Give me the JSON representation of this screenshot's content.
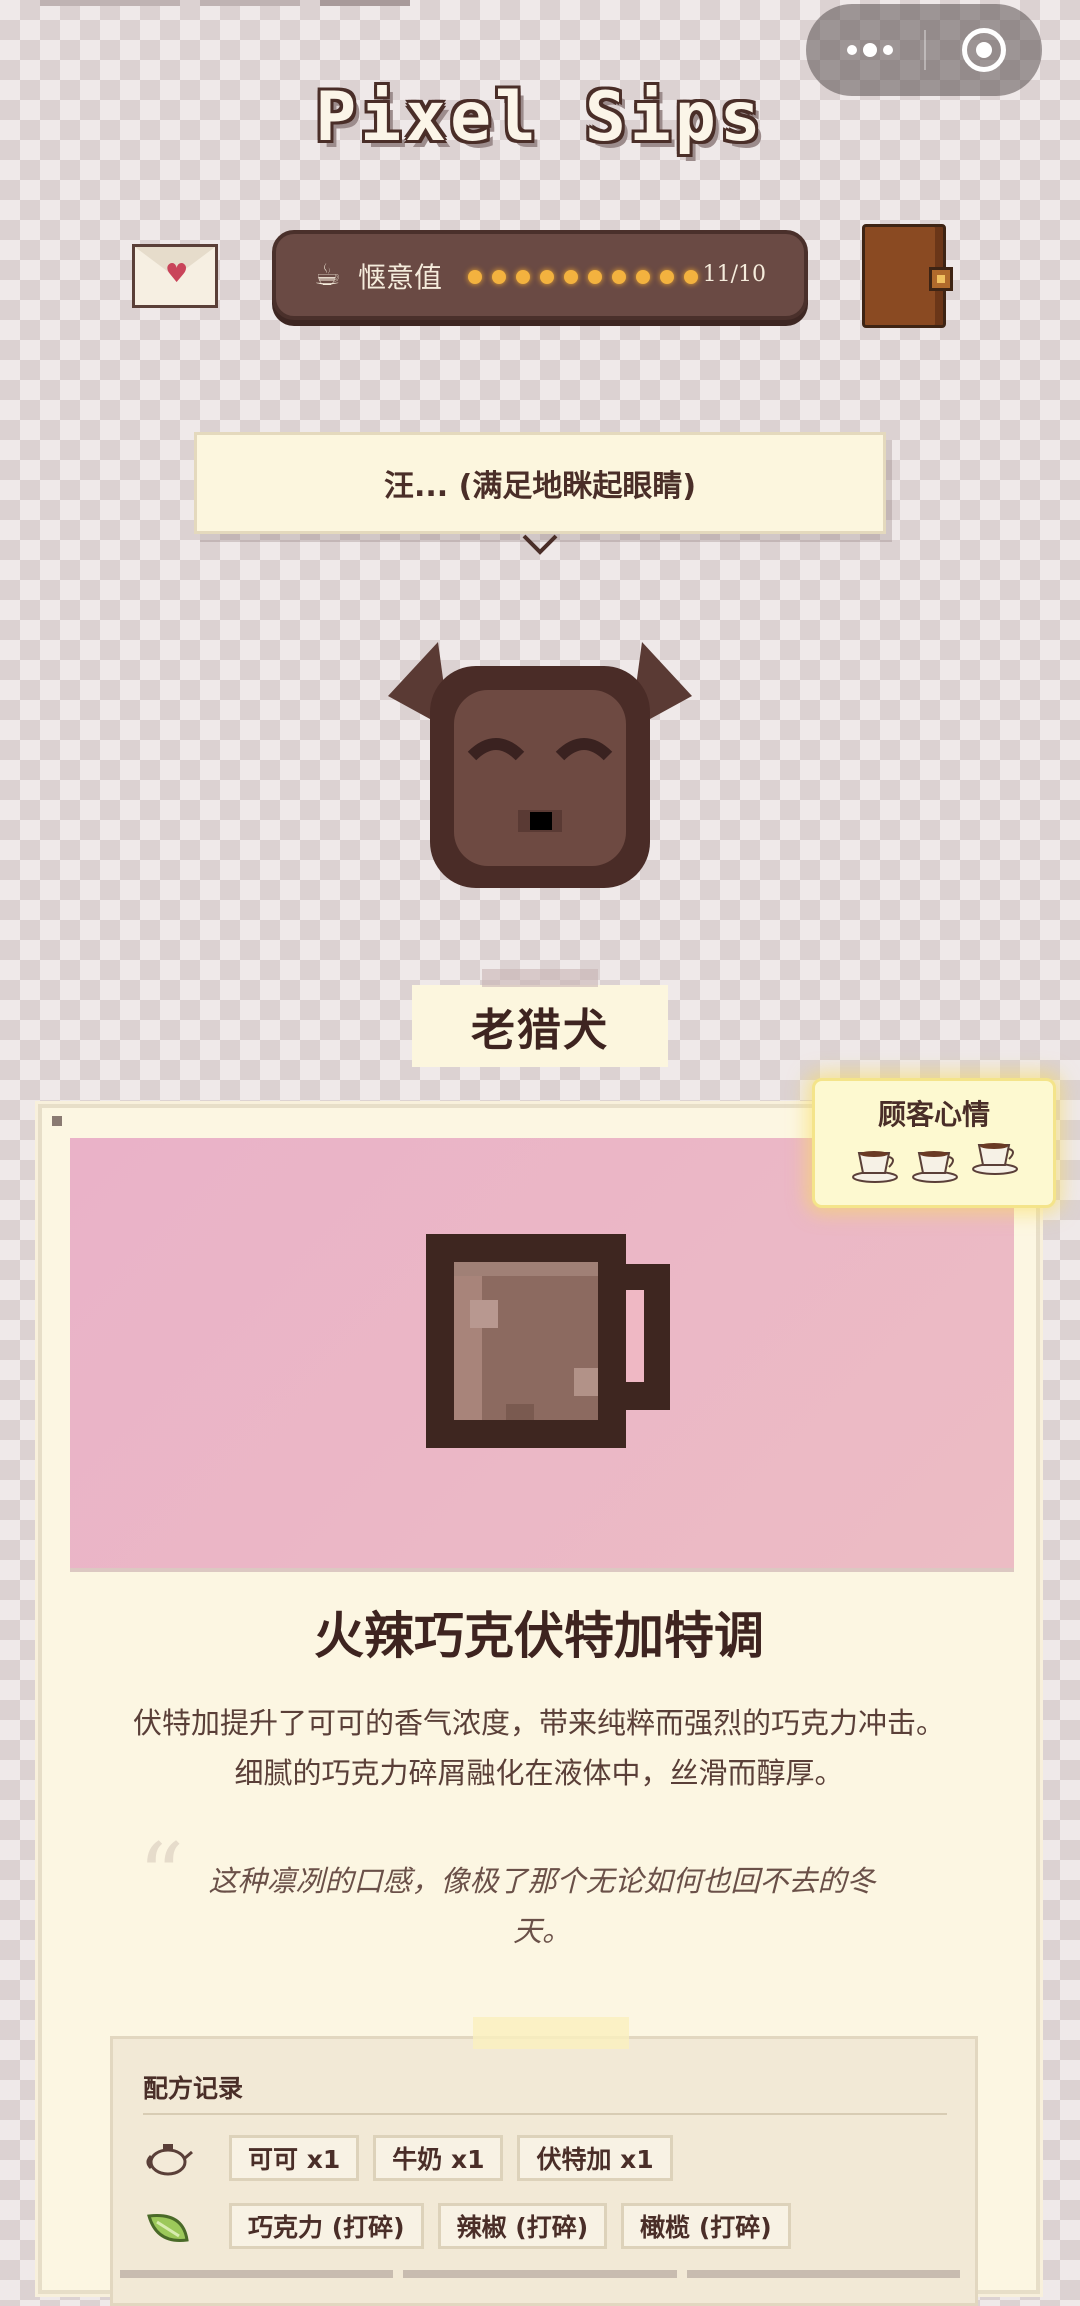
{
  "app": {
    "title": "Pixel Sips"
  },
  "header": {
    "comfort_label": "惬意值",
    "comfort_value": 11,
    "comfort_max": 10,
    "comfort_count_text": "11/10",
    "comfort_dot_count": 10,
    "accent_color": "#f3b23f"
  },
  "icons": {
    "letter": "envelope-heart-icon",
    "journal": "journal-book-icon",
    "more": "more-dots-icon",
    "close": "target-circle-icon"
  },
  "dialogue": {
    "text": "汪... (满足地眯起眼睛)"
  },
  "customer": {
    "name": "老猎犬"
  },
  "mood": {
    "title": "顾客心情",
    "cups": 3
  },
  "drink": {
    "name": "火辣巧克伏特加特调",
    "description": "伏特加提升了可可的香气浓度，带来纯粹而强烈的巧克力冲击。细腻的巧克力碎屑融化在液体中，丝滑而醇厚。",
    "quote": "这种凛冽的口感，像极了那个无论如何也回不去的冬天。"
  },
  "recipe": {
    "title": "配方记录",
    "liquids": [
      "可可 x1",
      "牛奶 x1",
      "伏特加 x1"
    ],
    "toppings": [
      "巧克力 (打碎)",
      "辣椒 (打碎)",
      "橄榄 (打碎)"
    ]
  }
}
